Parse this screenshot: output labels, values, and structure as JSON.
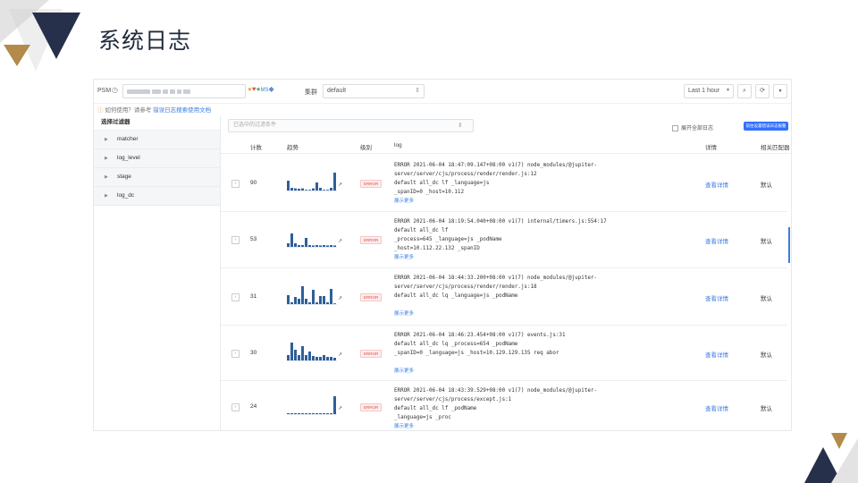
{
  "slide": {
    "title": "系统日志"
  },
  "topbar": {
    "psm_label": "PSM",
    "cluster_label": "集群",
    "cluster_value": "default",
    "time_range": "Last 1 hour"
  },
  "tip": {
    "prefix": "如何使用？请参考",
    "link": "错误日志搜索使用文档"
  },
  "sidebar": {
    "title": "选择过滤器",
    "items": [
      {
        "label": "matcher"
      },
      {
        "label": "log_level"
      },
      {
        "label": "stage"
      },
      {
        "label": "log_dc"
      }
    ]
  },
  "main": {
    "filter_placeholder": "已选中的过滤条件",
    "expand_all": "展开全部日志",
    "primary_button": "前往设置错误日志报警 >>",
    "columns": {
      "count": "计数",
      "trend": "趋势",
      "level": "级别",
      "log": "log",
      "detail": "详情",
      "match": "相关匹配器"
    },
    "rows": [
      {
        "count": "90",
        "level": "ERROR",
        "trend": [
          0.55,
          0.15,
          0.12,
          0.1,
          0.12,
          0,
          0,
          0.12,
          0.45,
          0.15,
          0,
          0,
          0.15,
          1.0
        ],
        "lines": [
          "ERROR 2021-06-04 18:47:09.147+08:00 v1(7) node_modules/@jupiter-",
          "server/server/cjs/process/render/render.js:12",
          "default all_dc lf _language=js",
          "_spanID=0 _host=10.112"
        ],
        "more": "展示更多",
        "detail": "查看详情",
        "match": "默认"
      },
      {
        "count": "53",
        "level": "ERROR",
        "trend": [
          0.2,
          0.75,
          0.2,
          0.1,
          0.1,
          0.5,
          0.1,
          0.08,
          0.1,
          0.08,
          0.1,
          0.08,
          0.1,
          0.08
        ],
        "lines": [
          "ERROR 2021-06-04 18:19:54.040+08:00 v1(7) internal/timers.js:554:17",
          "default all_dc lf",
          "_process=645 _language=js _podName",
          "_host=10.112.22.132 _spanID"
        ],
        "more": "展示更多",
        "detail": "查看详情",
        "match": "默认"
      },
      {
        "count": "31",
        "level": "ERROR",
        "trend": [
          0.5,
          0.1,
          0.4,
          0.3,
          1.0,
          0.3,
          0.1,
          0.8,
          0.1,
          0.45,
          0.45,
          0.1,
          0.85,
          0
        ],
        "lines": [
          "ERROR 2021-06-04 18:44:33.200+08:00 v1(7) node_modules/@jupiter-",
          "server/server/cjs/process/render/render.js:18",
          "default all_dc lq _language=js _podName",
          ""
        ],
        "more": "展示更多",
        "detail": "查看详情",
        "match": "默认"
      },
      {
        "count": "30",
        "level": "ERROR",
        "trend": [
          0.3,
          1.0,
          0.6,
          0.3,
          0.8,
          0.3,
          0.5,
          0.25,
          0.2,
          0.2,
          0.3,
          0.2,
          0.2,
          0.15
        ],
        "lines": [
          "ERROR 2021-06-04 18:46:23.454+08:00 v1(7) events.js:31",
          "default all_dc lq _process=654 _podName",
          "_spanID=0 _language=js _host=10.129.129.135 req abor",
          ""
        ],
        "more": "展示更多",
        "detail": "查看详情",
        "match": "默认"
      },
      {
        "count": "24",
        "level": "ERROR",
        "trend": [
          0.05,
          0.05,
          0.05,
          0.05,
          0.05,
          0.05,
          0.05,
          0.05,
          0.05,
          0.05,
          0.05,
          0.05,
          0.05,
          1.0
        ],
        "lines": [
          "ERROR 2021-06-04 18:43:39.529+08:00 v1(7) node_modules/@jupiter-",
          "server/server/cjs/process/except.js:1",
          "default all_dc lf _podName",
          "_language=js _proc"
        ],
        "more": "展示更多",
        "detail": "查看详情",
        "match": "默认"
      }
    ]
  },
  "colors": {
    "navy": "#27304a",
    "gold": "#b38a4a",
    "grey": "#c9c9c9",
    "accent": "#3370ff",
    "bar": "#2f5f9a",
    "error": "#e34a4a"
  }
}
